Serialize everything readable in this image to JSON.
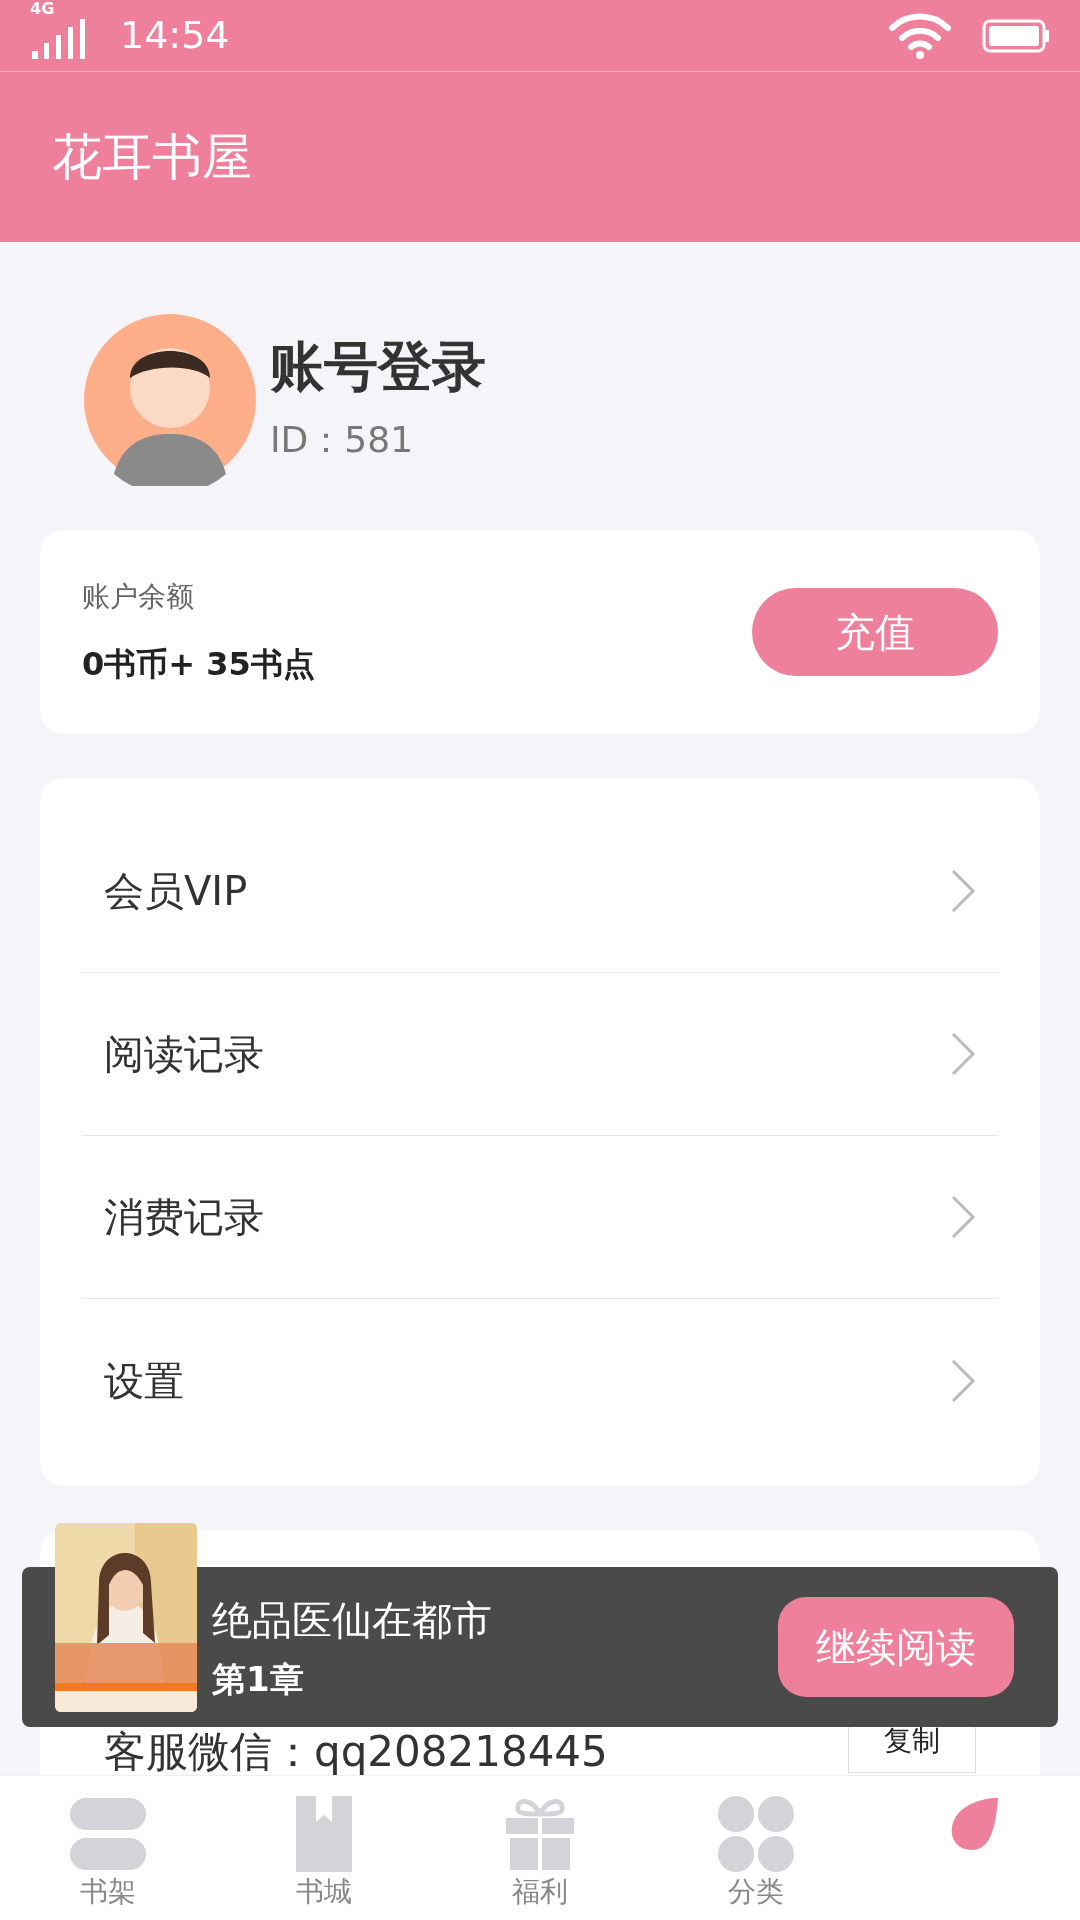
{
  "status_bar": {
    "network": "4G",
    "time": "14:54"
  },
  "header": {
    "title": "花耳书屋"
  },
  "profile": {
    "name": "账号登录",
    "id_label": "ID：",
    "id": "581"
  },
  "balance": {
    "label": "账户余额",
    "amount": "0书币+ 35书点",
    "button": "充值"
  },
  "menu": [
    {
      "label": "会员VIP"
    },
    {
      "label": "阅读记录"
    },
    {
      "label": "消费记录"
    },
    {
      "label": "设置"
    }
  ],
  "service": {
    "wechat": "客服微信：qq208218445",
    "copy_button": "复制"
  },
  "reading_banner": {
    "book_title": "绝品医仙在都市",
    "chapter": "第1章",
    "button": "继续阅读"
  },
  "tabs": [
    {
      "label": "书架",
      "kind": "shelf",
      "selected": false
    },
    {
      "label": "书城",
      "kind": "book",
      "selected": false
    },
    {
      "label": "福利",
      "kind": "gift",
      "selected": false
    },
    {
      "label": "分类",
      "kind": "grid",
      "selected": false
    },
    {
      "kind": "petal",
      "selected": true
    }
  ]
}
